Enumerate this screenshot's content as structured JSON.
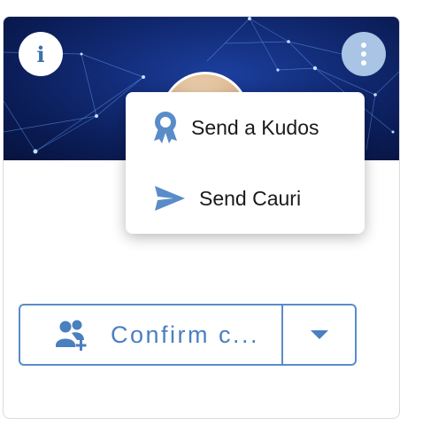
{
  "card": {
    "info_glyph": "i",
    "info_icon": "info-icon",
    "menu_icon": "kebab-menu-icon",
    "accent_color": "#5a8cc8"
  },
  "actions": {
    "confirm_label": "Confirm c...",
    "confirm_icon": "add-user-icon",
    "dropdown_icon": "caret-down-icon"
  },
  "menu": {
    "items": [
      {
        "label": "Send a Kudos",
        "icon": "award-ribbon-icon"
      },
      {
        "label": "Send Cauri",
        "icon": "paper-plane-icon"
      }
    ]
  }
}
